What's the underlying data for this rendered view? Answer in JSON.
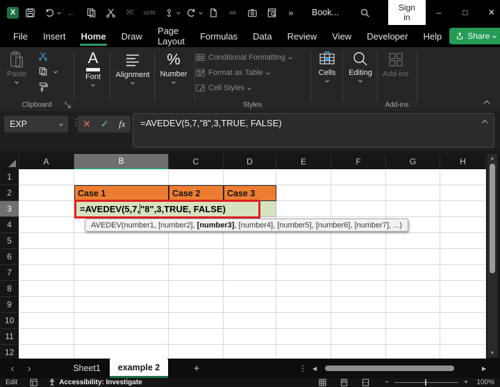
{
  "colors": {
    "excel_green": "#1E7145",
    "accent_green": "#2E9E6B",
    "share_button_green": "#259B56",
    "header_orange": "#ED7D31",
    "editing_fill_green": "#D5E3BE",
    "editing_border_red": "#DF1F1F",
    "ribbon_background": "#262626",
    "titlebar_background": "#000000"
  },
  "title_bar": {
    "title": "Book...",
    "sign_in_label": "Sign in",
    "icons": [
      "excel-logo",
      "save-icon",
      "undo-icon",
      "back-arrow-icon",
      "copy-icon",
      "cut-icon",
      "mail-icon",
      "translate-icon",
      "touch-mode-icon",
      "redo-icon",
      "new-file-icon",
      "strikethrough-icon",
      "camera-icon",
      "document-search-icon",
      "overflow-icon",
      "search-icon",
      "minimize-icon",
      "maximize-icon",
      "close-icon"
    ]
  },
  "ribbon": {
    "tabs": [
      {
        "label": "File"
      },
      {
        "label": "Insert"
      },
      {
        "label": "Home"
      },
      {
        "label": "Draw"
      },
      {
        "label": "Page Layout"
      },
      {
        "label": "Formulas"
      },
      {
        "label": "Data"
      },
      {
        "label": "Review"
      },
      {
        "label": "View"
      },
      {
        "label": "Developer"
      },
      {
        "label": "Help"
      }
    ],
    "active_tab": "Home",
    "share_label": "Share",
    "groups": {
      "clipboard": {
        "label": "Clipboard",
        "paste_label": "Paste"
      },
      "font": {
        "label": "Font"
      },
      "alignment": {
        "label": "Alignment"
      },
      "number": {
        "label": "Number"
      },
      "styles": {
        "label": "Styles",
        "items": [
          "Conditional Formatting",
          "Format as Table",
          "Cell Styles"
        ]
      },
      "cells": {
        "label": "Cells"
      },
      "editing": {
        "label": "Editing"
      },
      "addins": {
        "button_label": "Add-ins",
        "group_label": "Add-ins"
      }
    }
  },
  "formula_bar": {
    "name_box": "EXP",
    "formula": "=AVEDEV(5,7,\"8\",3,TRUE, FALSE)"
  },
  "grid": {
    "columns": [
      "A",
      "B",
      "C",
      "D",
      "E",
      "F",
      "G",
      "H"
    ],
    "rows": [
      "1",
      "2",
      "3",
      "4",
      "5",
      "6",
      "7",
      "8",
      "9",
      "10",
      "11",
      "12"
    ],
    "selected_column": "B",
    "selected_row": "3",
    "cells": {
      "B2": "Case 1",
      "C2": "Case 2",
      "D2": "Case 3"
    },
    "editing_cell": {
      "before_cursor": "=AVEDEV(5,7,",
      "after_cursor": "\"8\",3,TRUE, FALSE)"
    },
    "tooltip": {
      "prefix": "AVEDEV(number1, [number2], ",
      "bold": "[number3]",
      "suffix": ", [number4], [number5], [number6], [number7], ...)"
    }
  },
  "sheet_bar": {
    "tabs": [
      {
        "label": "Sheet1",
        "active": false
      },
      {
        "label": "example 2",
        "active": true
      }
    ]
  },
  "status_bar": {
    "mode": "Edit",
    "accessibility": "Accessibility: Investigate",
    "zoom_level": "100%"
  }
}
